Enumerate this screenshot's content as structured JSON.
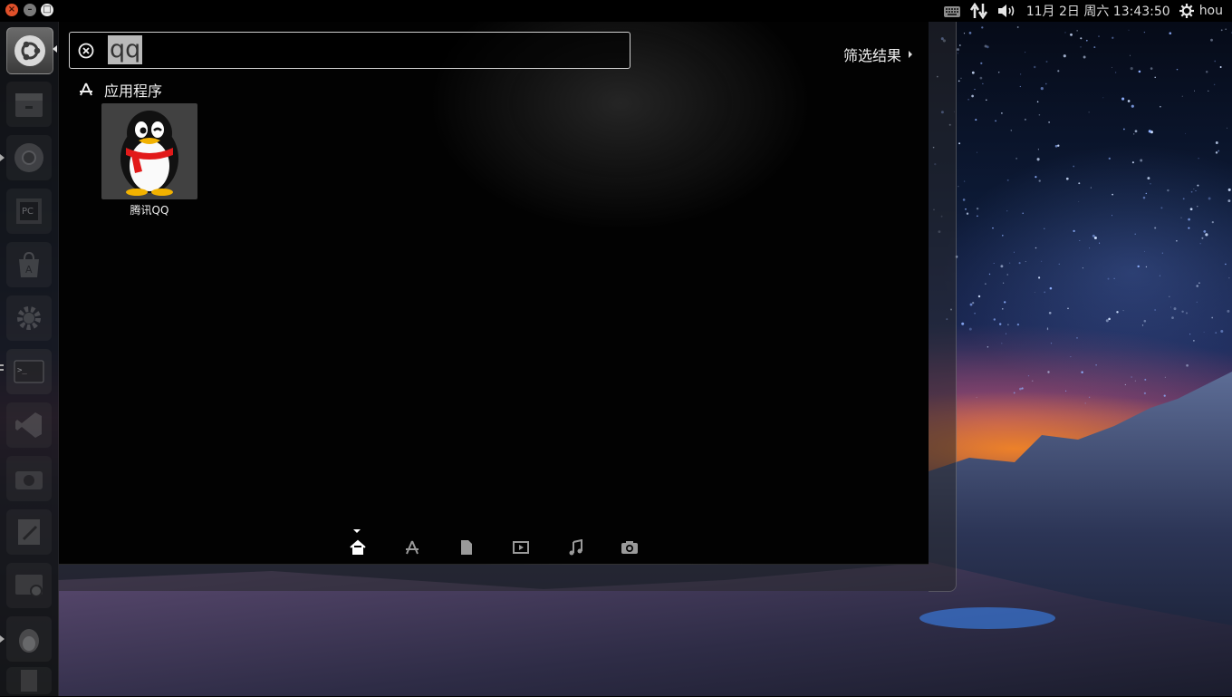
{
  "window_controls": {
    "close": "×",
    "minimize": "–",
    "maximize": "□"
  },
  "panel": {
    "datetime": "11月 2日 周六 13:43:50",
    "user": "hou",
    "indicators": [
      "keyboard-icon",
      "network-icon",
      "volume-icon",
      "gear-icon"
    ]
  },
  "launcher": {
    "items": [
      {
        "name": "dash-home",
        "icon": "ubuntu-logo-icon"
      },
      {
        "name": "files",
        "icon": "file-cabinet-icon"
      },
      {
        "name": "chrome",
        "icon": "chrome-icon"
      },
      {
        "name": "pycharm",
        "icon": "pycharm-icon"
      },
      {
        "name": "software-center",
        "icon": "shopping-bag-icon"
      },
      {
        "name": "system-settings",
        "icon": "gear-icon"
      },
      {
        "name": "terminal",
        "icon": "terminal-icon"
      },
      {
        "name": "vscode",
        "icon": "vscode-icon"
      },
      {
        "name": "screenshot",
        "icon": "camera-icon"
      },
      {
        "name": "text-editor",
        "icon": "text-editor-icon"
      },
      {
        "name": "webcam",
        "icon": "webcam-icon"
      },
      {
        "name": "qq",
        "icon": "qq-penguin-icon"
      }
    ]
  },
  "dash": {
    "search": {
      "value": "qq"
    },
    "filter_label": "筛选结果",
    "category_header": "应用程序",
    "results": [
      {
        "label": "腾讯QQ",
        "icon": "qq-penguin-icon"
      }
    ],
    "lenses": [
      "home-icon",
      "applications-icon",
      "files-icon",
      "video-icon",
      "music-icon",
      "photos-icon"
    ],
    "active_lens": "home-icon"
  },
  "colors": {
    "close": "#e0502a",
    "panel": "#000000",
    "dash_bg": "#020202"
  }
}
